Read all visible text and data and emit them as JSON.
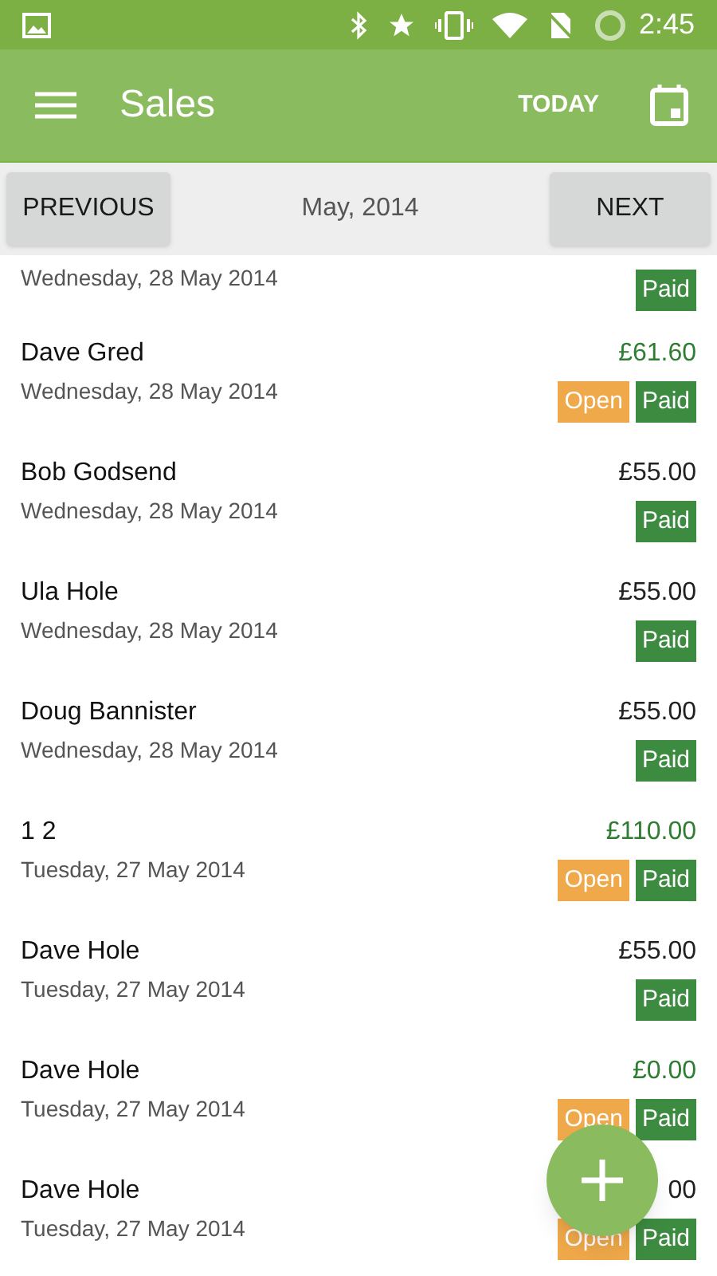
{
  "status_bar": {
    "time": "2:45"
  },
  "app_bar": {
    "title": "Sales",
    "action": "TODAY"
  },
  "period_nav": {
    "previous": "PREVIOUS",
    "label": "May, 2014",
    "next": "NEXT"
  },
  "sales": [
    {
      "date": "Wednesday, 28 May 2014",
      "badges": [
        {
          "kind": "paid",
          "label": "Paid"
        }
      ]
    },
    {
      "name": "Dave Gred",
      "date": "Wednesday, 28 May 2014",
      "amount": "£61.60",
      "color": "#2e7d32",
      "badges": [
        {
          "kind": "open",
          "label": "Open"
        },
        {
          "kind": "paid",
          "label": "Paid"
        }
      ]
    },
    {
      "name": "Bob Godsend",
      "date": "Wednesday, 28 May 2014",
      "amount": "£55.00",
      "color": "#212121",
      "badges": [
        {
          "kind": "paid",
          "label": "Paid"
        }
      ]
    },
    {
      "name": "Ula Hole",
      "date": "Wednesday, 28 May 2014",
      "amount": "£55.00",
      "color": "#212121",
      "badges": [
        {
          "kind": "paid",
          "label": "Paid"
        }
      ]
    },
    {
      "name": "Doug Bannister",
      "date": "Wednesday, 28 May 2014",
      "amount": "£55.00",
      "color": "#212121",
      "badges": [
        {
          "kind": "paid",
          "label": "Paid"
        }
      ]
    },
    {
      "name": "1 2",
      "date": "Tuesday, 27 May 2014",
      "amount": "£110.00",
      "color": "#2e7d32",
      "badges": [
        {
          "kind": "open",
          "label": "Open"
        },
        {
          "kind": "paid",
          "label": "Paid"
        }
      ]
    },
    {
      "name": "Dave Hole",
      "date": "Tuesday, 27 May 2014",
      "amount": "£55.00",
      "color": "#212121",
      "badges": [
        {
          "kind": "paid",
          "label": "Paid"
        }
      ]
    },
    {
      "name": "Dave Hole",
      "date": "Tuesday, 27 May 2014",
      "amount": "£0.00",
      "color": "#2e7d32",
      "badges": [
        {
          "kind": "open",
          "label": "Open"
        },
        {
          "kind": "paid",
          "label": "Paid"
        }
      ]
    },
    {
      "name": "Dave Hole",
      "date": "Tuesday, 27 May 2014",
      "amount": "00",
      "color": "#212121",
      "badges": [
        {
          "kind": "open",
          "label": "Open"
        },
        {
          "kind": "paid",
          "label": "Paid"
        }
      ]
    }
  ]
}
